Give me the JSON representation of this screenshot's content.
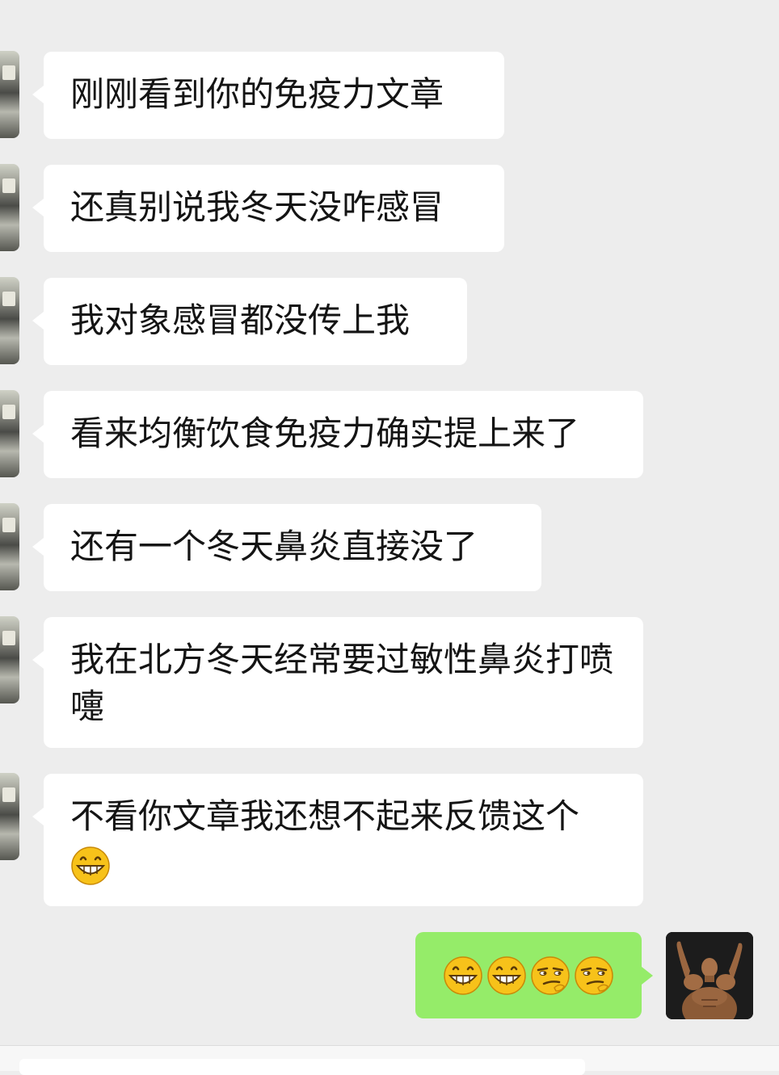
{
  "messages": [
    {
      "side": "left",
      "text": "刚刚看到你的免疫力文章"
    },
    {
      "side": "left",
      "text": "还真别说我冬天没咋感冒"
    },
    {
      "side": "left",
      "text": "我对象感冒都没传上我"
    },
    {
      "side": "left",
      "text": "看来均衡饮食免疫力确实提上来了"
    },
    {
      "side": "left",
      "text": "还有一个冬天鼻炎直接没了"
    },
    {
      "side": "left",
      "text": "我在北方冬天经常要过敏性鼻炎打喷嚏"
    },
    {
      "side": "left",
      "text": "不看你文章我还想不起来反馈这个",
      "emoji": "grin-emoji"
    },
    {
      "side": "right",
      "emojis": [
        "grin-emoji",
        "grin-emoji",
        "smirk-emoji",
        "smirk-emoji"
      ]
    }
  ],
  "colors": {
    "background": "#ededed",
    "bubble_left": "#ffffff",
    "bubble_right": "#95ec69",
    "text": "#141414",
    "emoji_face": "#f7c21a"
  }
}
